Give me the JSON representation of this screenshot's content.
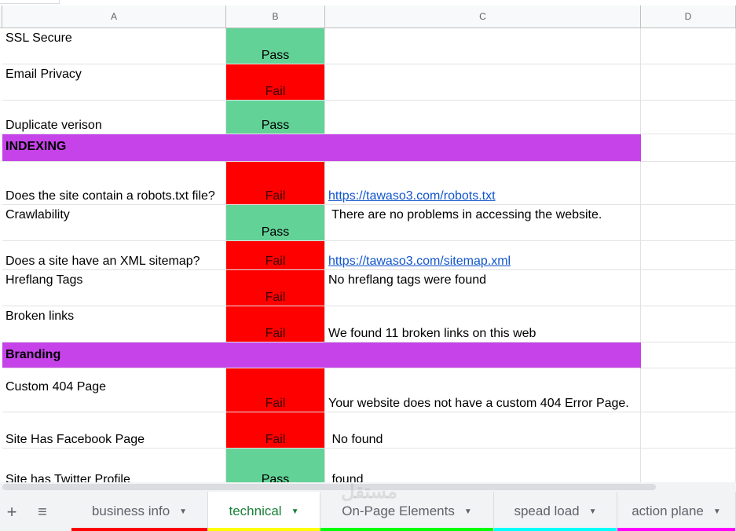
{
  "columns": [
    "A",
    "B",
    "C",
    "D"
  ],
  "rows": [
    {
      "a": "SSL Secure",
      "b": "Pass",
      "c": ""
    },
    {
      "a": "Email Privacy",
      "b": "Fail",
      "c": ""
    },
    {
      "a": "Duplicate verison",
      "b": "Pass",
      "c": ""
    },
    {
      "section": "INDEXING"
    },
    {
      "a": "Does the site contain a robots.txt file?",
      "b": "Fail",
      "c": "https://tawaso3.com/robots.txt",
      "c_link": true
    },
    {
      "a": "Crawlability",
      "b": "Pass",
      "c": " There are no problems in accessing the website."
    },
    {
      "a": "Does a site have an XML sitemap?",
      "b": "Fail",
      "c": "https://tawaso3.com/sitemap.xml",
      "c_link": true
    },
    {
      "a": "Hreflang Tags",
      "b": "Fail",
      "c": "No hreflang tags were found"
    },
    {
      "a": "Broken links",
      "b": "Fail",
      "c": "We found 11 broken links on this web"
    },
    {
      "section": "Branding"
    },
    {
      "a": "Custom 404 Page",
      "b": "Fail",
      "c": "Your website does not have a custom 404 Error Page."
    },
    {
      "a": "Site Has Facebook Page",
      "b": "Fail",
      "c": " No found"
    },
    {
      "a": "Site has Twitter Profile",
      "b": "Pass",
      "c": " found"
    }
  ],
  "tabs": [
    {
      "label": "business info",
      "color": "#ff0000",
      "active": false
    },
    {
      "label": "technical",
      "color": "#ffff00",
      "active": true
    },
    {
      "label": "On-Page Elements",
      "color": "#00ff00",
      "active": false
    },
    {
      "label": "spead load",
      "color": "#00ffff",
      "active": false
    },
    {
      "label": "action plane",
      "color": "#ff00ff",
      "active": false
    }
  ],
  "toolbar_icons": [
    "add-sheet-icon",
    "all-sheets-icon"
  ],
  "watermark": "مستقل",
  "colors": {
    "pass": "#63d297",
    "fail": "#ff0000",
    "section": "#c543e8",
    "link": "#1155cc",
    "active_tab_text": "#188038"
  }
}
